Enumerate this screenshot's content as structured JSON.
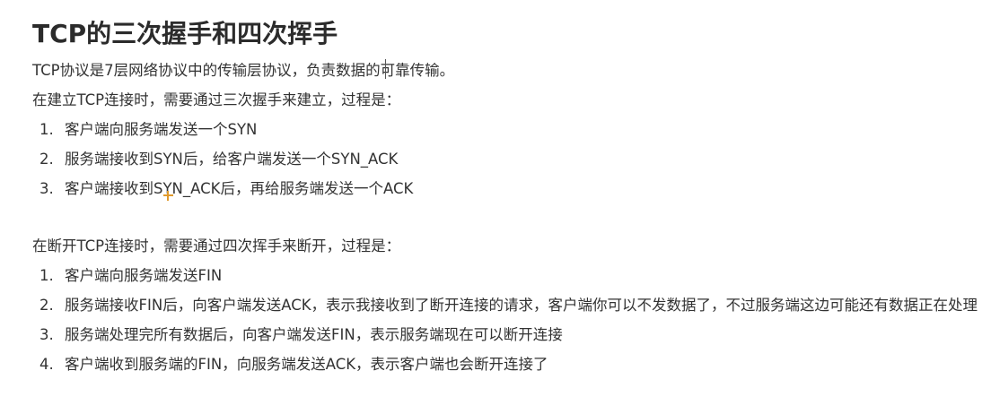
{
  "title": "TCP的三次握手和四次挥手",
  "intro": "TCP协议是7层网络协议中的传输层协议，负责数据的可靠传输。",
  "handshake": {
    "heading": "在建立TCP连接时，需要通过三次握手来建立，过程是：",
    "steps": [
      {
        "num": "1.",
        "text": "客户端向服务端发送一个SYN"
      },
      {
        "num": "2.",
        "text": "服务端接收到SYN后，给客户端发送一个SYN_ACK"
      },
      {
        "num": "3.",
        "text": "客户端接收到SYN_ACK后，再给服务端发送一个ACK"
      }
    ]
  },
  "wave": {
    "heading": "在断开TCP连接时，需要通过四次挥手来断开，过程是：",
    "steps": [
      {
        "num": "1.",
        "text": "客户端向服务端发送FIN"
      },
      {
        "num": "2.",
        "text": "服务端接收FIN后，向客户端发送ACK，表示我接收到了断开连接的请求，客户端你可以不发数据了，不过服务端这边可能还有数据正在处理"
      },
      {
        "num": "3.",
        "text": "服务端处理完所有数据后，向客户端发送FIN，表示服务端现在可以断开连接"
      },
      {
        "num": "4.",
        "text": "客户端收到服务端的FIN，向服务端发送ACK，表示客户端也会断开连接了"
      }
    ]
  },
  "icons": {
    "cursor": "plus-cursor-icon",
    "caret": "text-caret"
  },
  "colors": {
    "text": "#333333",
    "title": "#2b2b2b",
    "cursor": "#e09a2c"
  }
}
